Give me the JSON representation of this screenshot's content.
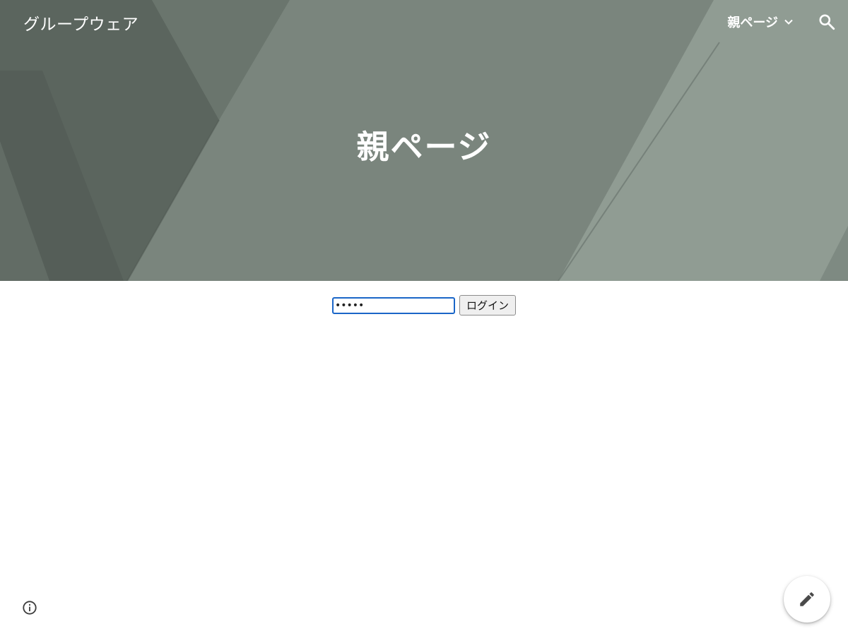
{
  "header": {
    "site_title": "グループウェア",
    "nav_item_label": "親ページ",
    "nav_item_icon": "chevron-down-icon",
    "search_icon": "search-icon"
  },
  "hero": {
    "page_title": "親ページ",
    "background_color": "#6f7a72"
  },
  "login": {
    "password_value": "•••••",
    "button_label": "ログイン",
    "focus_color": "#1a66c8"
  },
  "footer": {
    "info_icon": "info-icon",
    "edit_icon": "pencil-edit-icon"
  }
}
